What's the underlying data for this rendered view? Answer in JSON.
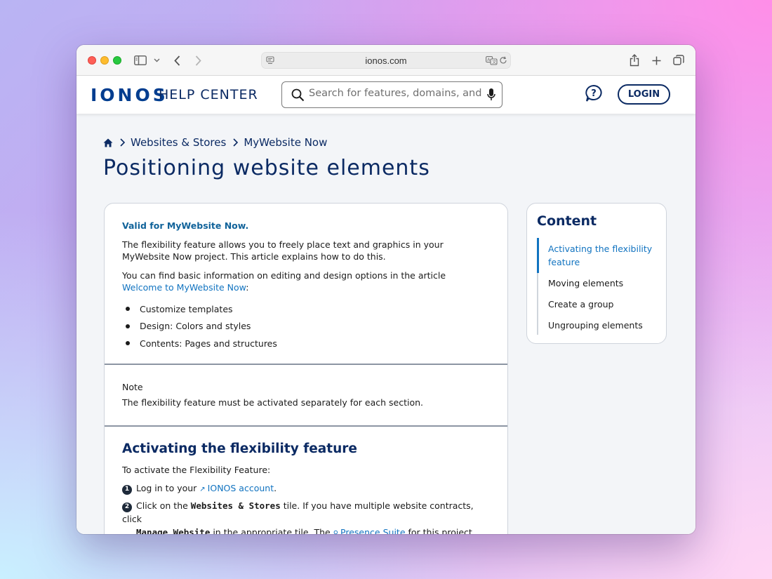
{
  "browser": {
    "url": "ionos.com"
  },
  "header": {
    "logo": "IONOS",
    "section_title": "HELP CENTER",
    "search_placeholder": "Search for features, domains, and help",
    "login_label": "LOGIN"
  },
  "breadcrumb": {
    "items": [
      "Websites & Stores",
      "MyWebsite Now"
    ]
  },
  "page_title": "Positioning website elements",
  "article": {
    "valid_for": "Valid for MyWebsite Now.",
    "intro_1": "The flexibility feature allows you to freely place text and graphics in your MyWebsite Now project. This article explains how to do this.",
    "intro_2_before": "You can find basic information on editing and design options in the article ",
    "intro_2_link": "Welcome to MyWebsite Now",
    "intro_2_after": ":",
    "bullets": [
      "Customize templates",
      "Design: Colors and styles",
      "Contents: Pages and structures"
    ],
    "note_label": "Note",
    "note_text": "The flexibility feature must be activated separately for each section.",
    "section_heading": "Activating the flexibility feature",
    "section_intro": "To activate the Flexibility Feature:",
    "step1_num": "1",
    "step1_before": "Log in to your ",
    "step1_link": "IONOS account",
    "step1_after": ".",
    "step2_num": "2",
    "step2_a": "Click on the ",
    "step2_code1": "Websites & Stores",
    "step2_b": " tile. If you have multiple website contracts, click",
    "step2_code2": "Manage Website",
    "step2_c": " in the appropriate tile. The ",
    "step2_link": "Presence Suite",
    "step2_d": " for this project opens."
  },
  "toc": {
    "title": "Content",
    "items": [
      "Activating the flexibility feature",
      "Moving elements",
      "Create a group",
      "Ungrouping elements"
    ]
  }
}
